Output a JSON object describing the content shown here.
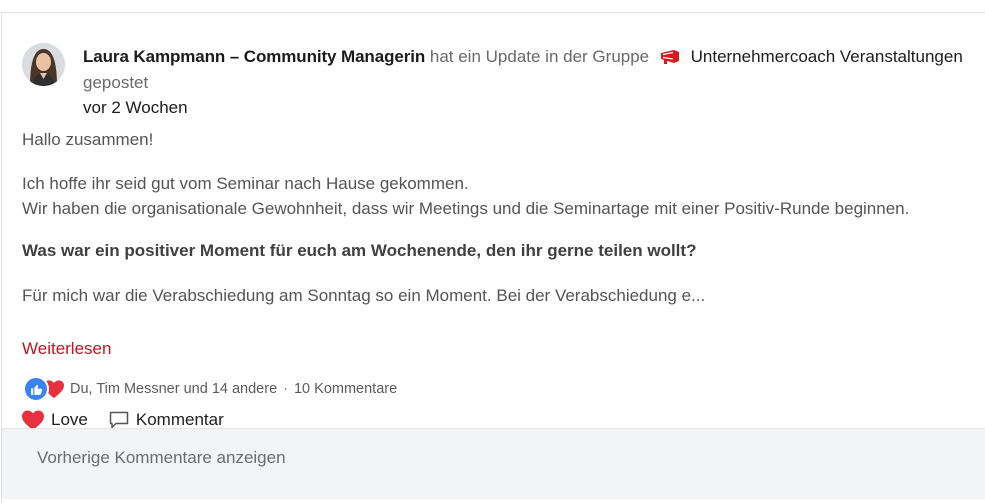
{
  "post": {
    "author": "Laura Kampmann – Community Managerin",
    "action_text": "hat ein Update in der Gruppe",
    "group_icon": "megaphone-icon",
    "group_name": "Unternehmercoach Veranstaltungen",
    "action_suffix": "gepostet",
    "time": "vor 2 Wochen",
    "paragraphs": {
      "greeting": "Hallo zusammen!",
      "line1": "Ich hoffe ihr seid gut vom Seminar nach Hause gekommen.",
      "line2": "Wir haben die organisationale Gewohnheit, dass wir Meetings und die Seminartage mit einer Positiv-Runde beginnen.",
      "question": "Was war ein positiver Moment für euch am Wochenende, den ihr gerne teilen wollt?",
      "excerpt": "Für mich war die Verabschiedung am Sonntag so ein Moment. Bei der Verabschiedung e..."
    },
    "read_more": "Weiterlesen"
  },
  "reactions": {
    "icons": [
      "like-icon",
      "love-icon"
    ],
    "summary": "Du, Tim Messner und 14 andere",
    "separator": "·",
    "comments_count": "10 Kommentare"
  },
  "actions": {
    "love_label": "Love",
    "comment_label": "Kommentar"
  },
  "comments": {
    "previous_label": "Vorherige Kommentare anzeigen"
  },
  "colors": {
    "accent_red": "#c0161d",
    "like_blue": "#3b82f6",
    "heart_red": "#e8313f",
    "comments_bg": "#f3f4f5"
  }
}
